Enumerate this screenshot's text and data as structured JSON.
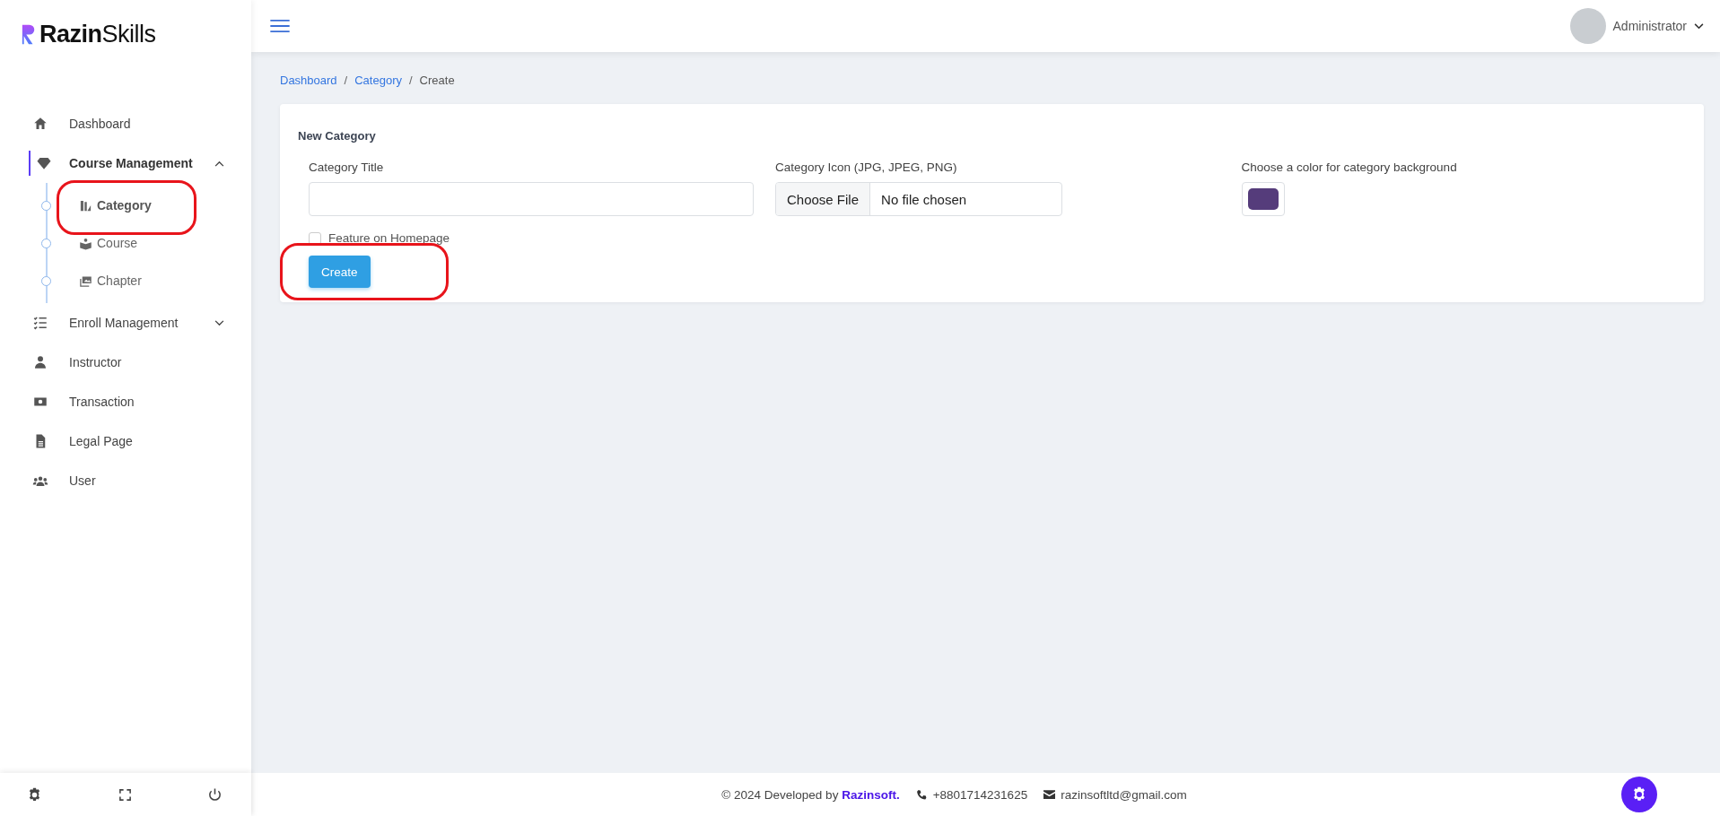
{
  "brand": {
    "name_bold": "Razin",
    "name_light": "Skills"
  },
  "topbar": {
    "user": "Administrator"
  },
  "sidebar": {
    "items": [
      {
        "kind": "link",
        "label": "Dashboard",
        "selected": false
      },
      {
        "kind": "group",
        "label": "Course Management",
        "selected": true,
        "expanded": true,
        "children": [
          {
            "label": "Category",
            "selected": true,
            "ringed": true
          },
          {
            "label": "Course",
            "selected": false,
            "ringed": false
          },
          {
            "label": "Chapter",
            "selected": false,
            "ringed": false
          }
        ]
      },
      {
        "kind": "group",
        "label": "Enroll Management",
        "selected": false,
        "expanded": false
      },
      {
        "kind": "link",
        "label": "Instructor",
        "selected": false
      },
      {
        "kind": "link",
        "label": "Transaction",
        "selected": false
      },
      {
        "kind": "link",
        "label": "Legal Page",
        "selected": false
      },
      {
        "kind": "link",
        "label": "User",
        "selected": false
      }
    ]
  },
  "breadcrumb": [
    {
      "label": "Dashboard",
      "current": false
    },
    {
      "separator": "/",
      "label": "Category",
      "current": false
    },
    {
      "separator": "/",
      "label": "Create",
      "current": true
    }
  ],
  "form": {
    "title": "New Category",
    "fields": [
      {
        "kind": "text",
        "label": "Category Title"
      },
      {
        "kind": "file",
        "label": "Category Icon (JPG, JPEG, PNG)",
        "button": "Choose File",
        "value": "No file chosen"
      },
      {
        "kind": "color",
        "label": "Choose a color for category background",
        "color": "#553c7b"
      }
    ],
    "checkbox": {
      "label": "Feature on Homepage",
      "checked": false
    },
    "submit": {
      "label": "Create",
      "ringed": true
    }
  },
  "footer": {
    "copyright": "© 2024 Developed by",
    "company": "Razinsoft.",
    "phone": "+8801714231625",
    "email": "razinsoftltd@gmail.com"
  }
}
